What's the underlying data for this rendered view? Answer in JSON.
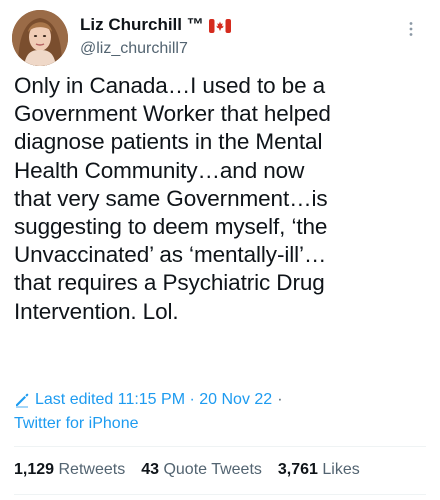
{
  "tweet": {
    "author": {
      "display_name": "Liz Churchill ™",
      "handle": "@liz_churchill7",
      "flag": "canada-flag-icon"
    },
    "text": "Only in Canada…I used to be a\nGovernment Worker that helped\ndiagnose patients in the Mental\nHealth Community…and now\nthat very same Government…is\nsuggesting to deem myself, ‘the\nUnvaccinated’ as ‘mentally-ill’…\nthat requires a Psychiatric Drug\nIntervention. Lol.",
    "edited_label": "Last edited 11:15 PM · 20 Nov 22",
    "separator": "·",
    "source": "Twitter for iPhone",
    "stats": {
      "retweets_count": "1,129",
      "retweets_label": "Retweets",
      "quotes_count": "43",
      "quotes_label": "Quote Tweets",
      "likes_count": "3,761",
      "likes_label": "Likes"
    }
  },
  "colors": {
    "accent": "#1d9bf0",
    "secondary_text": "#536471",
    "primary_text": "#0f1419",
    "flag_red": "#d52b1e"
  }
}
